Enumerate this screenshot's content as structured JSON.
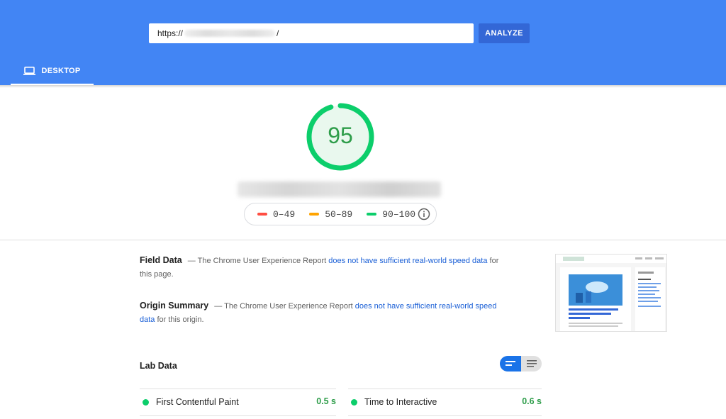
{
  "search": {
    "url_prefix": "https://",
    "url_suffix": "/",
    "analyze_label": "ANALYZE"
  },
  "tabs": [
    {
      "label": "DESKTOP",
      "icon": "laptop-icon",
      "active": true
    }
  ],
  "score": {
    "value": "95",
    "fraction": 0.95,
    "color": "#0cce6b"
  },
  "legend": {
    "items": [
      {
        "label": "0–49",
        "color": "#ff4e42"
      },
      {
        "label": "50–89",
        "color": "#ffa400"
      },
      {
        "label": "90–100",
        "color": "#0cce6b"
      }
    ],
    "info_icon": "info-icon"
  },
  "field_data": {
    "title": "Field Data",
    "text_before": "— The Chrome User Experience Report ",
    "link": "does not have sufficient real-world speed data",
    "text_after": " for this page."
  },
  "origin_summary": {
    "title": "Origin Summary",
    "text_before": "— The Chrome User Experience Report ",
    "link": "does not have sufficient real-world speed data",
    "text_after": " for this origin."
  },
  "lab_data": {
    "title": "Lab Data",
    "metrics": [
      {
        "label": "First Contentful Paint",
        "value": "0.5 s",
        "status": "pass"
      },
      {
        "label": "Time to Interactive",
        "value": "0.6 s",
        "status": "pass"
      }
    ]
  },
  "colors": {
    "header": "#4285f4",
    "button": "#3367d6",
    "link": "#1a5fd6",
    "pass": "#0cce6b"
  }
}
